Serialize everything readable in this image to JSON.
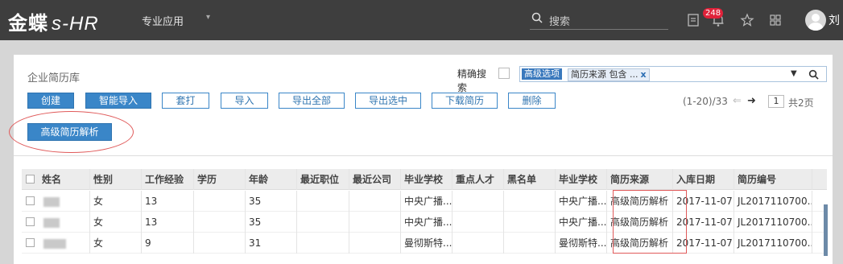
{
  "header": {
    "logo_main": "金蝶",
    "logo_sub": "s-HR",
    "menu_label": "专业应用",
    "menu_caret": "▾",
    "search_placeholder": "搜索",
    "notification_count": "248",
    "user_name": "刘"
  },
  "page": {
    "title": "企业简历库",
    "exact_search_label": "精确搜索",
    "filter": {
      "adv_tag": "高级选项",
      "source_tag": "简历来源 包含 ...",
      "remove": "x"
    }
  },
  "toolbar": {
    "create": "创建",
    "smart_import": "智能导入",
    "print": "套打",
    "import": "导入",
    "export_all": "导出全部",
    "export_selected": "导出选中",
    "download": "下载简历",
    "delete": "删除",
    "adv_parse": "高级简历解析"
  },
  "pager": {
    "range": "(1-20)/33",
    "prev": "⇐",
    "next": "➜",
    "current_page": "1",
    "total": "共2页"
  },
  "table": {
    "columns": [
      "姓名",
      "性别",
      "工作经验",
      "学历",
      "年龄",
      "最近职位",
      "最近公司",
      "毕业学校",
      "重点人才",
      "黑名单",
      "毕业学校",
      "简历来源",
      "入库日期",
      "简历编号"
    ],
    "rows": [
      [
        "",
        "女",
        "13",
        "",
        "35",
        "",
        "",
        "中央广播...",
        "",
        "",
        "中央广播...",
        "高级简历解析",
        "2017-11-07",
        "JL2017110700..."
      ],
      [
        "",
        "女",
        "13",
        "",
        "35",
        "",
        "",
        "中央广播...",
        "",
        "",
        "中央广播...",
        "高级简历解析",
        "2017-11-07",
        "JL2017110700..."
      ],
      [
        "",
        "女",
        "9",
        "",
        "31",
        "",
        "",
        "曼彻斯特...",
        "",
        "",
        "曼彻斯特...",
        "高级简历解析",
        "2017-11-07",
        "JL2017110700..."
      ]
    ]
  },
  "colors": {
    "topbar": "#3e3e3e",
    "primary": "#3a86c8",
    "highlight": "#e05a5a",
    "badge": "#e0223a"
  }
}
